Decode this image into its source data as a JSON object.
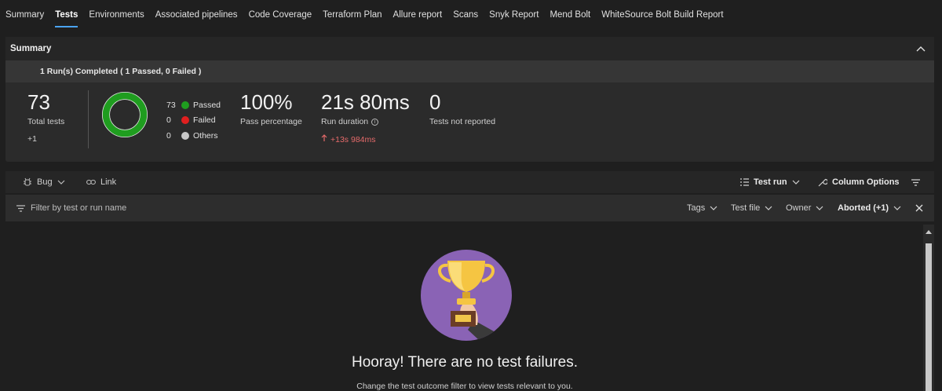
{
  "tabs": [
    {
      "label": "Summary",
      "active": false
    },
    {
      "label": "Tests",
      "active": true
    },
    {
      "label": "Environments",
      "active": false
    },
    {
      "label": "Associated pipelines",
      "active": false
    },
    {
      "label": "Code Coverage",
      "active": false
    },
    {
      "label": "Terraform Plan",
      "active": false
    },
    {
      "label": "Allure report",
      "active": false
    },
    {
      "label": "Scans",
      "active": false
    },
    {
      "label": "Snyk Report",
      "active": false
    },
    {
      "label": "Mend Bolt",
      "active": false
    },
    {
      "label": "WhiteSource Bolt Build Report",
      "active": false
    }
  ],
  "summary": {
    "title": "Summary",
    "runs_completed": "1 Run(s) Completed ( 1 Passed, 0 Failed )",
    "total_tests": {
      "value": "73",
      "label": "Total tests",
      "delta": "+1"
    },
    "outcomes": [
      {
        "count": "73",
        "label": "Passed",
        "color": "#1f9d1f"
      },
      {
        "count": "0",
        "label": "Failed",
        "color": "#e01f1f"
      },
      {
        "count": "0",
        "label": "Others",
        "color": "#c8c8c8"
      }
    ],
    "pass_percentage": {
      "value": "100%",
      "label": "Pass percentage"
    },
    "run_duration": {
      "value": "21s 80ms",
      "label": "Run duration",
      "delta": "+13s 984ms"
    },
    "not_reported": {
      "value": "0",
      "label": "Tests not reported"
    },
    "donut_pass_fraction": 1.0
  },
  "toolbar": {
    "bug_label": "Bug",
    "link_label": "Link",
    "test_run_label": "Test run",
    "column_options_label": "Column Options"
  },
  "filterbar": {
    "placeholder": "Filter by test or run name",
    "tags_label": "Tags",
    "test_file_label": "Test file",
    "owner_label": "Owner",
    "outcome_label": "Aborted (+1)"
  },
  "empty_state": {
    "title": "Hooray! There are no test failures.",
    "subtitle": "Change the test outcome filter to view tests relevant to you."
  },
  "colors": {
    "accent": "#4aa3f0",
    "trophy_circle": "#8a63b5",
    "delta_red": "#e46a6a"
  }
}
